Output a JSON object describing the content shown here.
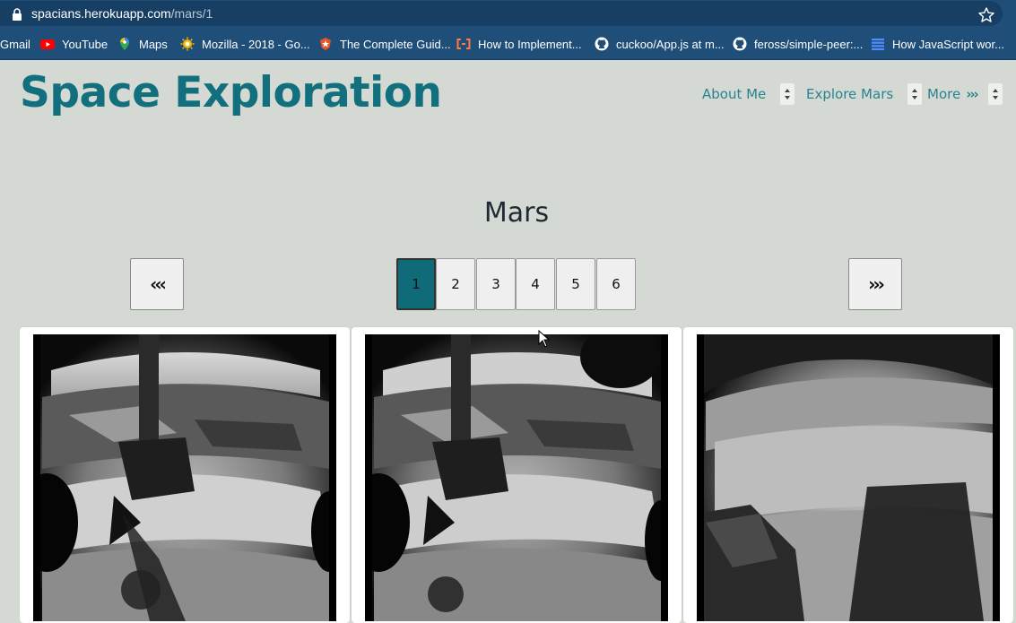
{
  "browser": {
    "url_host": "spacians.herokuapp.com",
    "url_path": "/mars/1",
    "bookmarks": [
      {
        "label": "Gmail",
        "icon": "gmail-icon"
      },
      {
        "label": "YouTube",
        "icon": "youtube-icon"
      },
      {
        "label": "Maps",
        "icon": "maps-icon"
      },
      {
        "label": "Mozilla - 2018 - Go...",
        "icon": "mozilla-icon"
      },
      {
        "label": "The Complete Guid...",
        "icon": "auth0-icon"
      },
      {
        "label": "How to Implement...",
        "icon": "code-bracket-icon"
      },
      {
        "label": "cuckoo/App.js at m...",
        "icon": "github-icon"
      },
      {
        "label": "feross/simple-peer:...",
        "icon": "github-icon"
      },
      {
        "label": "How JavaScript wor...",
        "icon": "doc-list-icon"
      }
    ]
  },
  "header": {
    "site_title": "Space Exploration",
    "nav": {
      "about": "About Me",
      "explore": "Explore Mars",
      "more": "More",
      "more_arrows": "›››"
    }
  },
  "main": {
    "section_title": "Mars",
    "pager": {
      "prev": "‹‹‹",
      "next": "›››",
      "pages": [
        "1",
        "2",
        "3",
        "4",
        "5",
        "6"
      ],
      "current": "1"
    },
    "photos": [
      {
        "name": "mars-photo-1"
      },
      {
        "name": "mars-photo-2"
      },
      {
        "name": "mars-photo-3"
      }
    ]
  },
  "colors": {
    "page_bg": "#d4dad3",
    "title": "#12707e",
    "nav_link": "#2a8290",
    "active_page": "#0f6b78",
    "browser_chrome": "#1f4e79"
  }
}
